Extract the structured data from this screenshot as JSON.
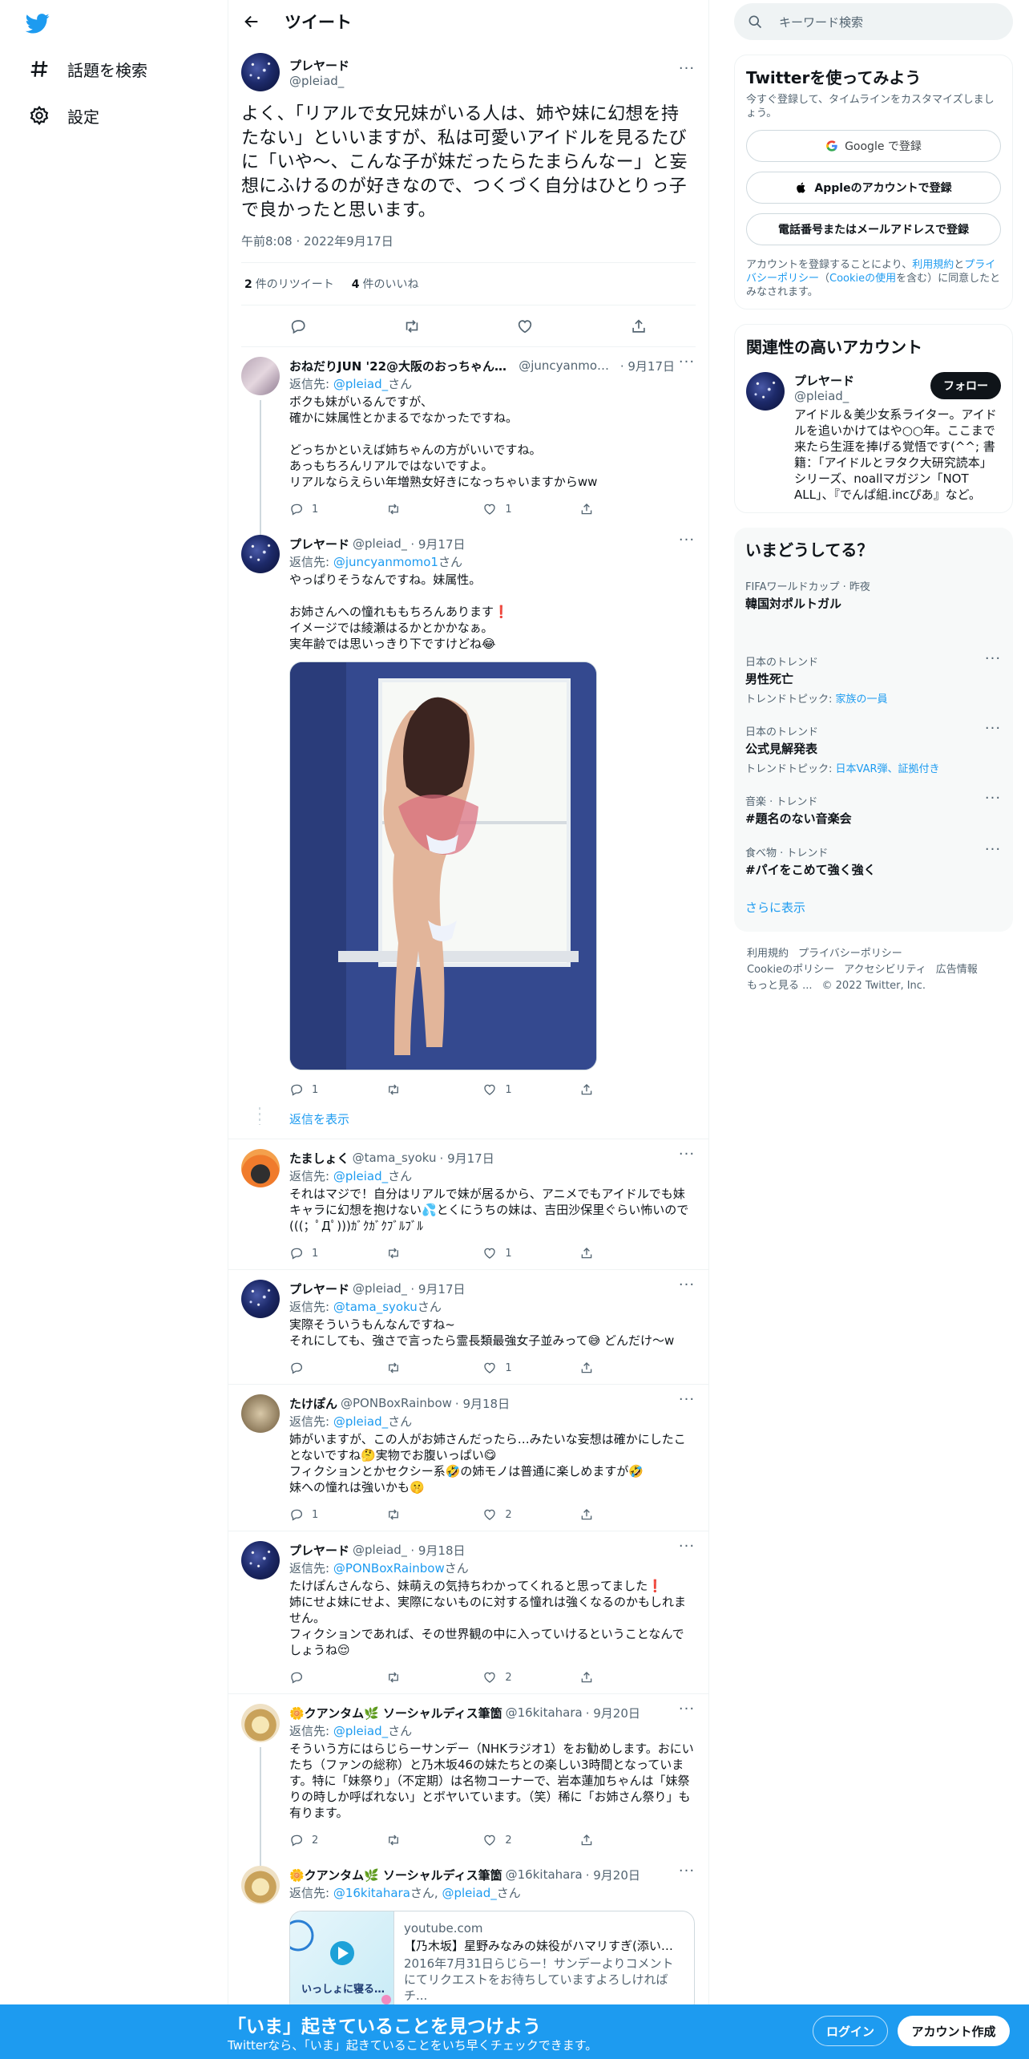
{
  "nav": {
    "explore_label": "話題を検索",
    "settings_label": "設定"
  },
  "header": {
    "title": "ツイート"
  },
  "main_tweet": {
    "name": "プレヤード",
    "handle": "@pleiad_",
    "text": "よく、「リアルで女兄妹がいる人は、姉や妹に幻想を持たない」といいますが、私は可愛いアイドルを見るたびに「いや～、こんな子が妹だったらたまらんなー」と妄想にふけるのが好きなので、つくづく自分はひとりっ子で良かったと思います。",
    "time": "午前8:08 · 2022年9月17日",
    "retweets_count": "2",
    "retweets_label": "件のリツイート",
    "likes_count": "4",
    "likes_label": "件のいいね"
  },
  "replies": [
    {
      "name": "おねだりJUN '22@大阪のおっちゃん🧡...",
      "handle": "@juncyanmom...",
      "date": "· 9月17日",
      "reply_prefix": "返信先: ",
      "reply_to": "@pleiad_",
      "reply_suffix": "さん",
      "text": "ボクも妹がいるんですが、\n確かに妹属性とかまるでなかったですね。\n\nどっちかといえば姉ちゃんの方がいいですね。\nあっもちろんリアルではないですよ。\nリアルならえらい年増熟女好きになっちゃいますからww",
      "replies": "1",
      "retweets": "",
      "likes": "1"
    },
    {
      "name": "プレヤード",
      "handle": "@pleiad_",
      "date": "· 9月17日",
      "reply_prefix": "返信先: ",
      "reply_to": "@juncyanmomo1",
      "reply_suffix": "さん",
      "text": "やっぱりそうなんですね。妹属性。\n\nお姉さんへの憧れももちろんあります❗\nイメージでは綾瀬はるかとかかなぁ。\n実年齢では思いっきり下ですけどね😂",
      "replies": "1",
      "retweets": "",
      "likes": "1"
    },
    {
      "name": "たましょく",
      "handle": "@tama_syoku",
      "date": "· 9月17日",
      "reply_prefix": "返信先: ",
      "reply_to": "@pleiad_",
      "reply_suffix": "さん",
      "text": "それはマジで！自分はリアルで妹が居るから、アニメでもアイドルでも妹キャラに幻想を抱けない💦とくにうちの妹は、吉田沙保里ぐらい怖いので(((；ﾟДﾟ)))ｶﾞｸｶﾞｸﾌﾞﾙﾌﾞﾙ",
      "replies": "1",
      "retweets": "",
      "likes": "1"
    },
    {
      "name": "プレヤード",
      "handle": "@pleiad_",
      "date": "· 9月17日",
      "reply_prefix": "返信先: ",
      "reply_to": "@tama_syoku",
      "reply_suffix": "さん",
      "text": "実際そういうもんなんですね~\nそれにしても、強さで言ったら霊長類最強女子並みって😅 どんだけ～w",
      "replies": "",
      "retweets": "",
      "likes": "1"
    },
    {
      "name": "たけぽん",
      "handle": "@PONBoxRainbow",
      "date": "· 9月18日",
      "reply_prefix": "返信先: ",
      "reply_to": "@pleiad_",
      "reply_suffix": "さん",
      "text": "姉がいますが、この人がお姉さんだったら…みたいな妄想は確かにしたことないですね🤔実物でお腹いっぱい😋\nフィクションとかセクシー系🤣の姉モノは普通に楽しめますが🤣\n妹への憧れは強いかも🤫",
      "replies": "1",
      "retweets": "",
      "likes": "2"
    },
    {
      "name": "プレヤード",
      "handle": "@pleiad_",
      "date": "· 9月18日",
      "reply_prefix": "返信先: ",
      "reply_to": "@PONBoxRainbow",
      "reply_suffix": "さん",
      "text": "たけぽんさんなら、妹萌えの気持ちわかってくれると思ってました❗\n姉にせよ妹にせよ、実際にないものに対する憧れは強くなるのかもしれません。\nフィクションであれば、その世界観の中に入っていけるということなんでしょうね😌",
      "replies": "",
      "retweets": "",
      "likes": "2"
    },
    {
      "name": "🌼クアンタム🌿 ソーシャルディス筆箇",
      "handle": "@16kitahara",
      "date": "· 9月20日",
      "reply_prefix": "返信先: ",
      "reply_to": "@pleiad_",
      "reply_suffix": "さん",
      "text": "そういう方にはらじらーサンデー（NHKラジオ1）をお勧めします。おにいたち（ファンの総称）と乃木坂46の妹たちとの楽しい3時間となっています。特に「妹祭り」（不定期）は名物コーナーで、岩本蓮加ちゃんは「妹祭りの時しか呼ばれない」とボヤいています。（笑）稀に「お姉さん祭り」も有ります。",
      "replies": "2",
      "retweets": "",
      "likes": "2"
    },
    {
      "name": "🌼クアンタム🌿 ソーシャルディス筆箇",
      "handle": "@16kitahara",
      "date": "· 9月20日",
      "reply_prefix": "返信先: ",
      "reply_to": "@16kitahara",
      "reply_suffix": "さん, ",
      "reply_to2": "@pleiad_",
      "reply_suffix2": "さん"
    }
  ],
  "show_replies_label": "返信を表示",
  "card": {
    "thumb_text": "いっしょに寝る…",
    "domain": "youtube.com",
    "title": "【乃木坂】星野みなみの妹役がハマリすぎ(添い寝...",
    "description": "2016年7月31日らじらー！サンデーよりコメントにてリクエストをお待ちしていますよろしければチ..."
  },
  "sidebar": {
    "search_placeholder": "キーワード検索",
    "signup": {
      "title": "Twitterを使ってみよう",
      "subtitle": "今すぐ登録して、タイムラインをカスタマイズしましょう。",
      "google_label": "Google で登録",
      "apple_label": "Appleのアカウントで登録",
      "phone_label": "電話番号またはメールアドレスで登録",
      "legal_1": "アカウントを登録することにより、",
      "legal_terms": "利用規約",
      "legal_2": "と",
      "legal_privacy": "プライバシーポリシー",
      "legal_3": "（",
      "legal_cookie": "Cookieの使用",
      "legal_4": "を含む）に同意したとみなされます。"
    },
    "related": {
      "title": "関連性の高いアカウント",
      "name": "プレヤード",
      "handle": "@pleiad_",
      "follow_label": "フォロー",
      "bio": "アイドル＆美少女系ライター。アイドルを追いかけてはや○○年。ここまで来たら生涯を捧げる覚悟です(^^; 書籍：「アイドルとヲタク大研究読本」シリーズ、noallマガジン「NOT ALL」、『でんぱ組.incぴあ』など。"
    },
    "trends": {
      "title": "いまどうしてる？",
      "items": [
        {
          "context": "FIFAワールドカップ · 昨夜",
          "title": "韓国対ポルトガル",
          "topic_label": "",
          "topic": ""
        },
        {
          "context": "日本のトレンド",
          "title": "男性死亡",
          "topic_label": "トレンドトピック: ",
          "topic": "家族の一員"
        },
        {
          "context": "日本のトレンド",
          "title": "公式見解発表",
          "topic_label": "トレンドトピック: ",
          "topic": "日本VAR弾、証拠付き"
        },
        {
          "context": "音楽 · トレンド",
          "title": "#題名のない音楽会",
          "topic_label": "",
          "topic": ""
        },
        {
          "context": "食べ物 · トレンド",
          "title": "#パイをこめて強く強く",
          "topic_label": "",
          "topic": ""
        }
      ],
      "show_more": "さらに表示"
    },
    "footer": {
      "terms": "利用規約",
      "privacy": "プライバシーポリシー",
      "cookie": "Cookieのポリシー",
      "accessibility": "アクセシビリティ",
      "ads": "広告情報",
      "more": "もっと見る ...",
      "copyright": "© 2022 Twitter, Inc."
    }
  },
  "bottom_bar": {
    "title": "「いま」起きていることを見つけよう",
    "subtitle": "Twitterなら、「いま」起きていることをいち早くチェックできます。",
    "login_label": "ログイン",
    "signup_label": "アカウント作成"
  },
  "colors": {
    "accent": "#1d9bf0",
    "text": "#0f1419",
    "muted": "#536471",
    "border": "#eff3f4"
  }
}
